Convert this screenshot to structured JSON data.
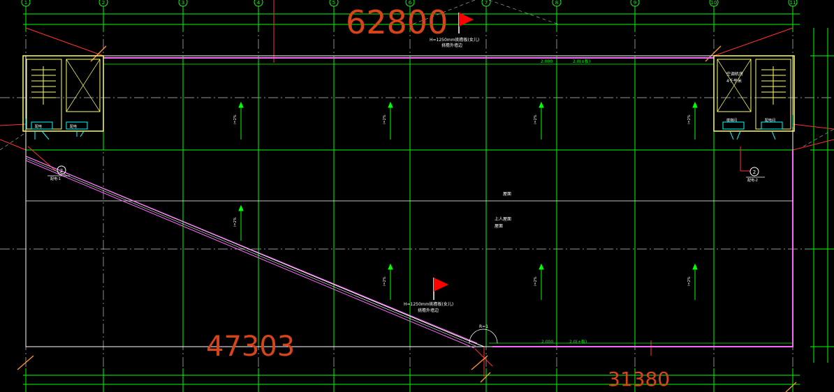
{
  "canvas": {
    "background": "#000000",
    "colors": {
      "grid": "#00ff00",
      "axis_dash": "#c8c8c8",
      "outline_pink": "#ff66ff",
      "outline_white": "#ffffff",
      "big_dim": "#d8441a",
      "red_ext": "#ff3333",
      "flag": "#ff0000",
      "wall": "#ffff66",
      "cyan": "#00ffff",
      "annot_green": "#22dd22",
      "dim_orange": "#ff9933"
    }
  },
  "axes": {
    "labels": [
      "1",
      "2",
      "3",
      "4",
      "5",
      "6",
      "7",
      "8",
      "9",
      "10",
      "11"
    ]
  },
  "dimensions": {
    "big_top": "62800",
    "big_bottom_left": "47303",
    "big_bottom_right": "31380"
  },
  "annotations": {
    "top_flag_text": "H=1250mm挑檐板(女儿)",
    "top_flag_sub": "挑檐外墙边",
    "mid_flag_text": "H=1250mm挑檐板(女儿)",
    "mid_flag_sub": "挑檐外墙边",
    "roof_label": "屋面",
    "roof_note_1": "上人屋面",
    "roof_note_2": "屋面",
    "room_right": "空调机房",
    "room_right_sub": "4千平米",
    "balloon_left": "2",
    "balloon_right": "2",
    "balloon_left_sub": "配电-1",
    "balloon_right_sub": "配电-2",
    "stair_left_1": "配电",
    "stair_left_2": "配电",
    "stair_right_1": "楼梯间",
    "stair_right_2": "配电间",
    "slope_label": "i=2%",
    "gutter_top_1": "2.000",
    "gutter_top_2": "2.0(±板)",
    "gutter_bottom_1": "2.000",
    "gutter_bottom_2": "2.0(±板)",
    "arc_label": "R=1"
  }
}
